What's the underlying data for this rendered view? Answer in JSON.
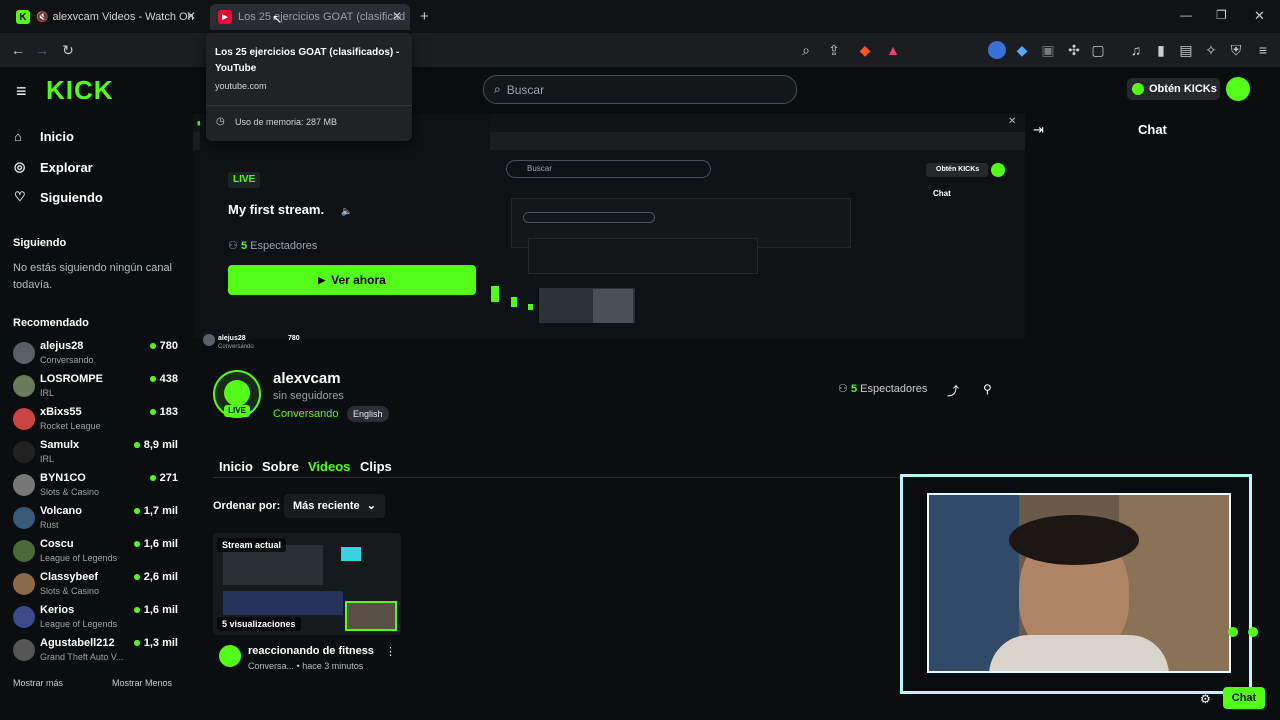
{
  "browser": {
    "tabs": [
      {
        "label": "alexvcam Videos - Watch On",
        "icon": "kick-icon"
      },
      {
        "label": "Los 25 ejercicios GOAT (clasificad",
        "icon": "youtube-icon"
      }
    ],
    "tooltip": {
      "title": "Los 25 ejercicios GOAT (clasificados) - YouTube",
      "domain": "youtube.com",
      "memory": "Uso de memoria: 287 MB"
    }
  },
  "kick": {
    "logo": "KICK",
    "search_placeholder": "Buscar",
    "get_kicks": "Obtén KICKs",
    "nav": {
      "inicio": "Inicio",
      "explorar": "Explorar",
      "siguiendo": "Siguiendo"
    },
    "following_heading": "Siguiendo",
    "following_empty": "No estás siguiendo ningún canal todavía.",
    "recommended_heading": "Recomendado",
    "recommended": [
      {
        "name": "alejus28",
        "category": "Conversando",
        "viewers": "780"
      },
      {
        "name": "LOSROMPE",
        "category": "IRL",
        "viewers": "438"
      },
      {
        "name": "xBixs55",
        "category": "Rocket League",
        "viewers": "183"
      },
      {
        "name": "Samulx",
        "category": "IRL",
        "viewers": "8,9 mil"
      },
      {
        "name": "BYN1CO",
        "category": "Slots & Casino",
        "viewers": "271"
      },
      {
        "name": "Volcano",
        "category": "Rust",
        "viewers": "1,7 mil"
      },
      {
        "name": "Coscu",
        "category": "League of Legends",
        "viewers": "1,6 mil"
      },
      {
        "name": "Classybeef",
        "category": "Slots & Casino",
        "viewers": "2,6 mil"
      },
      {
        "name": "Kerios",
        "category": "League of Legends",
        "viewers": "1,6 mil"
      },
      {
        "name": "Agustabell212",
        "category": "Grand Theft Auto V...",
        "viewers": "1,3 mil"
      }
    ],
    "show_more": "Mostrar más",
    "show_less": "Mostrar Menos",
    "chat_title": "Chat",
    "live_card": {
      "badge": "LIVE",
      "title": "My first stream.",
      "viewers_num": "5",
      "viewers_label": "Espectadores",
      "watch_now": "Ver ahora"
    },
    "channel": {
      "name": "alexvcam",
      "followers": "sin seguidores",
      "category": "Conversando",
      "language": "English",
      "live_badge": "LIVE",
      "viewers_num": "5",
      "viewers_label": "Espectadores",
      "tabs": [
        "Inicio",
        "Sobre",
        "Videos",
        "Clips"
      ]
    },
    "sort": {
      "label": "Ordenar por:",
      "value": "Más reciente"
    },
    "video": {
      "badge": "Stream actual",
      "views": "5 visualizaciones",
      "title": "reaccionando de fitness",
      "meta": "Conversa...",
      "age": "hace 3 minutos"
    },
    "chat_button": "Chat"
  },
  "mini": {
    "rec_name": "alejus28",
    "rec_cat": "Conversando",
    "rec_views": "780",
    "search": "Buscar",
    "kicks": "Obtén KICKs",
    "chat": "Chat"
  },
  "colors": {
    "accent": "#53fc18",
    "bg": "#0b0e0f"
  }
}
